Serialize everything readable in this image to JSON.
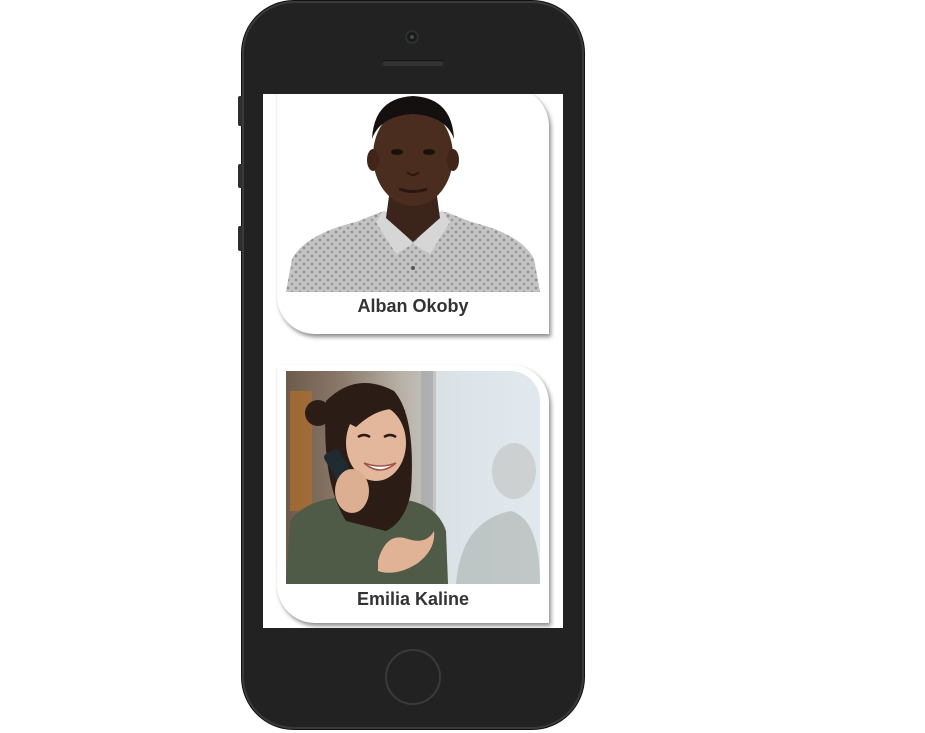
{
  "profiles": [
    {
      "name": "Alban Okoby"
    },
    {
      "name": "Emilia Kaline"
    }
  ],
  "icons": {
    "home": "home-button",
    "camera": "front-camera",
    "speaker": "earpiece-speaker"
  },
  "colors": {
    "phone_body": "#222222",
    "screen_bg": "#ffffff",
    "name_text": "#333333"
  }
}
